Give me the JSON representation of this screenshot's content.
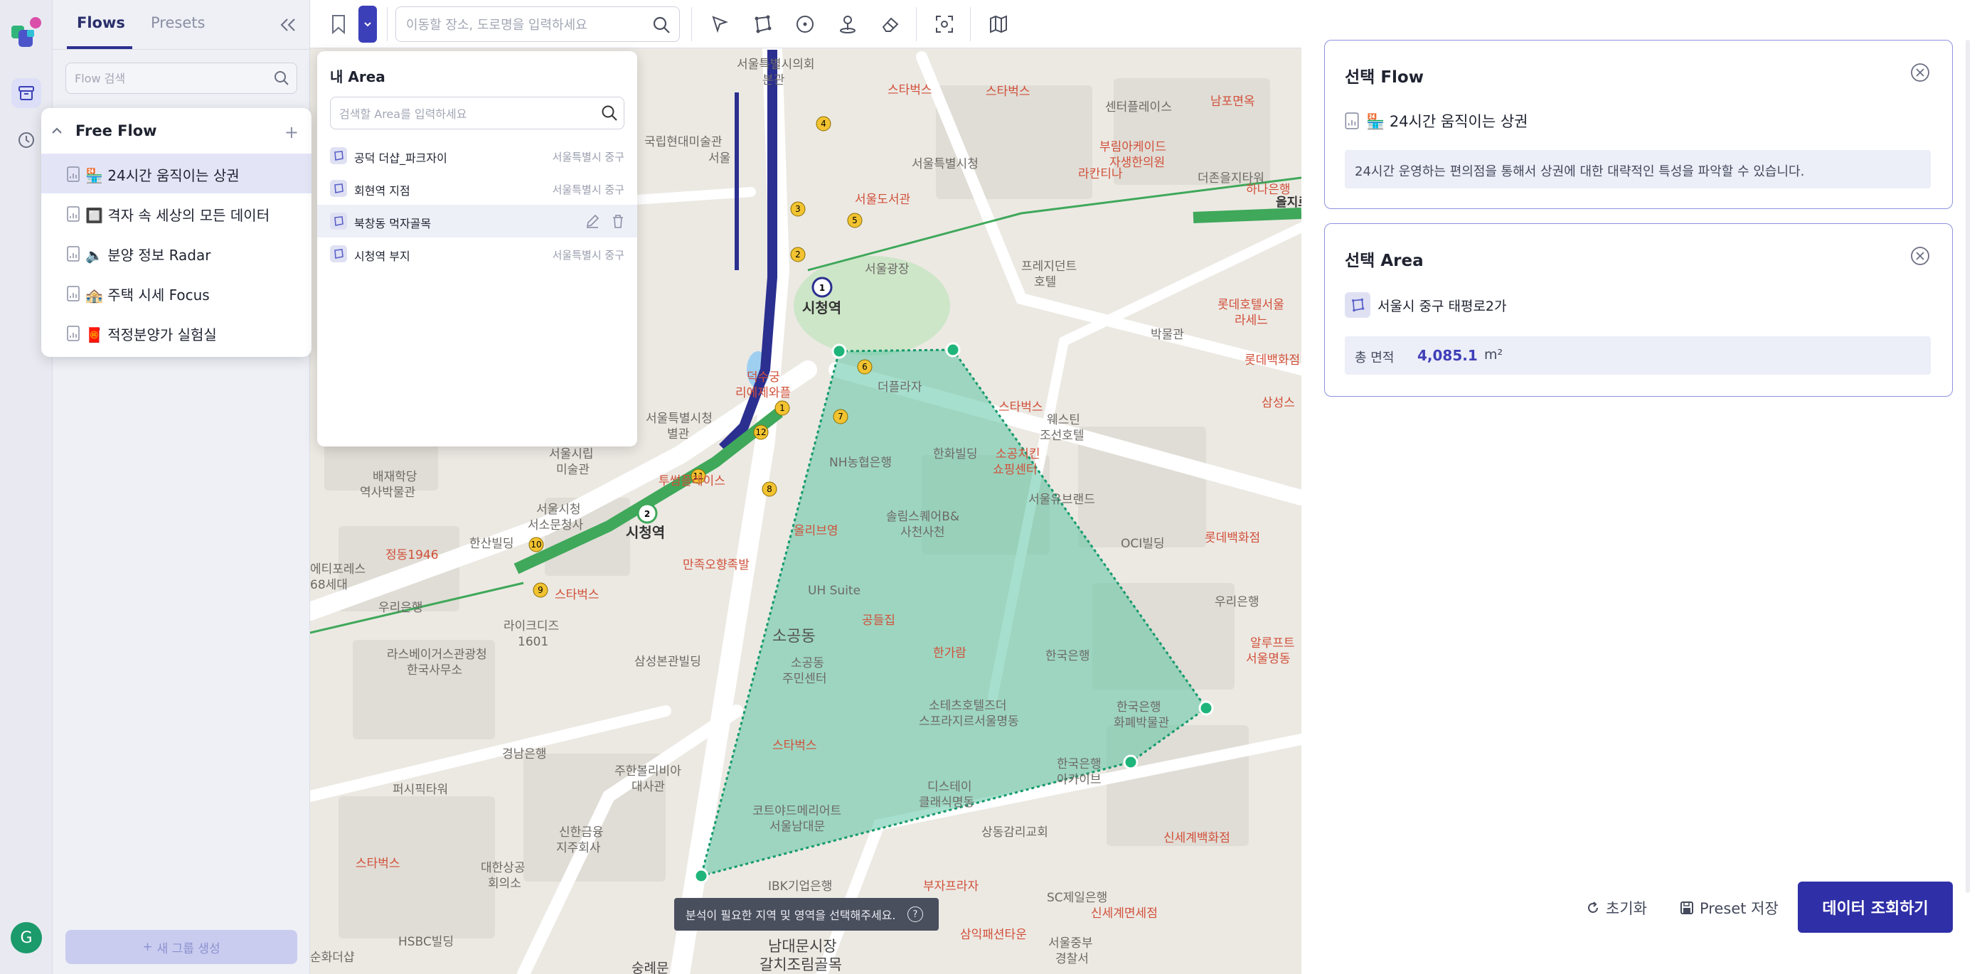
{
  "colors": {
    "accent": "#2f2fa8",
    "selected_bg": "#e3e5f7",
    "polygon_fill": "#5cc5a4",
    "polygon_stroke": "#159a6c",
    "subway_line1": "#2b2f8f",
    "subway_line2": "#3fa85a"
  },
  "rail": {
    "avatar_initial": "G"
  },
  "flows_panel": {
    "tabs": [
      "Flows",
      "Presets"
    ],
    "search_placeholder": "Flow 검색",
    "new_group_label": "새 그룹 생성",
    "group": {
      "name": "Free Flow",
      "items": [
        {
          "label": "🏪 24시간 움직이는 상권",
          "selected": true
        },
        {
          "label": "🔲 격자 속 세상의 모든 데이터",
          "selected": false
        },
        {
          "label": "🔈 분양 정보 Radar",
          "selected": false
        },
        {
          "label": "🏤 주택 시세 Focus",
          "selected": false
        },
        {
          "label": "🧧 적정분양가 실험실",
          "selected": false
        }
      ]
    }
  },
  "toolbar": {
    "place_search_placeholder": "이동할 장소, 도로명을 입력하세요",
    "tools": [
      "select-arrow-icon",
      "polygon-icon",
      "circle-icon",
      "pin-icon",
      "eraser-icon",
      "capture-icon",
      "map-icon"
    ]
  },
  "area_dropdown": {
    "title": "내 Area",
    "search_placeholder": "검색할 Area를 입력하세요",
    "items": [
      {
        "name": "공덕 더샵_파크자이",
        "region": "서울특별시 중구"
      },
      {
        "name": "회현역 지점",
        "region": "서울특별시 중구"
      },
      {
        "name": "북창동 먹자골목",
        "region": ""
      },
      {
        "name": "시청역 부지",
        "region": "서울특별시 중구"
      }
    ]
  },
  "map": {
    "hint": "분석이 필요한 지역 및 영역을 선택해주세요.",
    "labels": [
      "서울특별시의회 본관",
      "국립현대미술관 서울",
      "스타벅스",
      "스타벅스",
      "센터플레이스",
      "남포면옥",
      "서울특별시청",
      "부림아케이드 자생한의원",
      "더존을지타워",
      "하나은행",
      "서울도서관",
      "라칸티나",
      "을지로",
      "서울광장",
      "프레지던트 호텔",
      "롯데호텔서울 라세느",
      "박물관",
      "시청역",
      "덕수궁 리에제와플",
      "더플라자",
      "롯데백화점",
      "서울특별시청 별관",
      "스타벅스",
      "웨스틴 조선호텔",
      "삼성스",
      "서울시립 미술관",
      "한화빌딩",
      "소공치킨 쇼핑센터",
      "NH농협은행",
      "배재학당 역사박물관",
      "서울시청 서소문청사",
      "투썸플레이스",
      "서울유브랜드",
      "롯데백화점",
      "솔림스퀘어B& 사천사천",
      "올리브영",
      "OCI빌딩",
      "한산빌딩",
      "정동1946",
      "시청역",
      "만족오향족발",
      "에티포레스 68세대",
      "UH Suite",
      "우리은행",
      "스타벅스",
      "우리은행",
      "공들집",
      "라이크디즈 1601",
      "한가람",
      "한국은행",
      "라스베이거스관광청 한국사무소",
      "소공동",
      "삼성본관빌딩",
      "소공동 주민센터",
      "알루프트 서울명동",
      "소테츠호텔즈더 스프라지르서울명동",
      "한국은행 화폐박물관",
      "스타벅스",
      "경남은행",
      "주한볼리비아 대사관",
      "퍼시픽타워",
      "코트야드메리어트 서울남대문",
      "디스테이 클래식명동",
      "한국은행 아카이브",
      "상동감리교회",
      "신세계백화점",
      "신한금융 지주회사",
      "스타벅스",
      "대한상공 회의소",
      "IBK기업은행",
      "부자프라자",
      "SC제일은행",
      "신세계면세점",
      "HSBC빌딩",
      "삼익패션타운",
      "서울중부 경찰서",
      "남대문시장 갈치조림골목",
      "숭례문",
      "순화더샵"
    ]
  },
  "right_panel": {
    "flow_card": {
      "title": "선택 Flow",
      "name": "🏪 24시간 움직이는 상권",
      "description": "24시간 운영하는 편의점을 통해서 상권에 대한 대략적인 특성을 파악할 수 있습니다."
    },
    "area_card": {
      "title": "선택 Area",
      "name": "서울시 중구 태평로2가",
      "stat_label": "총 면적",
      "stat_value": "4,085.1",
      "stat_unit": "m²"
    },
    "actions": {
      "reset": "초기화",
      "preset": "Preset 저장",
      "query": "데이터 조회하기"
    }
  }
}
